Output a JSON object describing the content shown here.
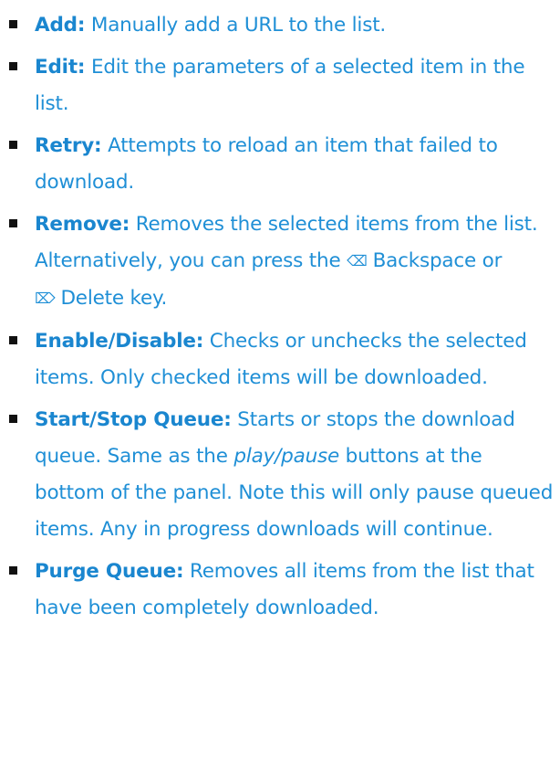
{
  "items": [
    {
      "term": "Add:",
      "desc": " Manually add a URL to the list."
    },
    {
      "term": "Edit:",
      "desc": " Edit the parameters of a selected item in the list."
    },
    {
      "term": "Retry:",
      "desc": " Attempts to reload an item that failed to download."
    },
    {
      "term": "Remove:",
      "desc": " Removes the selected items from the list. Alternatively, you can press the ",
      "key1_glyph": "⌫",
      "key1_label": "Backspace",
      "or": " or ",
      "key2_glyph": "⌦",
      "key2_label": "Delete",
      "tail": " key."
    },
    {
      "term": "Enable/Disable:",
      "desc": " Checks or unchecks the selected items. Only checked items will be downloaded."
    },
    {
      "term": "Start/Stop Queue:",
      "desc": " Starts or stops the download queue. Same as the ",
      "emphasis": "play/pause",
      "tail": " buttons at the bottom of the panel. Note this will only pause queued items. Any in progress downloads will continue."
    },
    {
      "term": "Purge Queue:",
      "desc": " Removes all items from the list that have been completely downloaded."
    }
  ]
}
